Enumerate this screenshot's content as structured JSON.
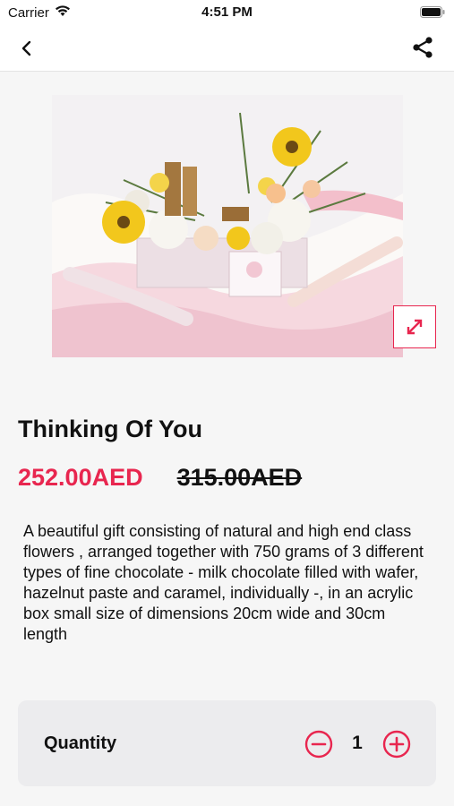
{
  "status_bar": {
    "carrier": "Carrier",
    "time": "4:51 PM"
  },
  "nav": {
    "back_icon": "chevron-left-icon",
    "share_icon": "share-icon"
  },
  "product": {
    "image_alt": "flower-and-chocolate-arrangement-photo",
    "title": "Thinking Of You",
    "price": "252.00AED",
    "old_price": "315.00AED",
    "description": "A beautiful gift consisting of natural and high end class flowers , arranged together with 750 grams of 3 different types of fine chocolate - milk chocolate filled with wafer, hazelnut paste and caramel, individually -, in an acrylic box small size of dimensions 20cm wide and 30cm length"
  },
  "quantity": {
    "label": "Quantity",
    "value": "1"
  },
  "colors": {
    "accent": "#e8264f",
    "background": "#f6f6f6",
    "card": "#ececee"
  }
}
